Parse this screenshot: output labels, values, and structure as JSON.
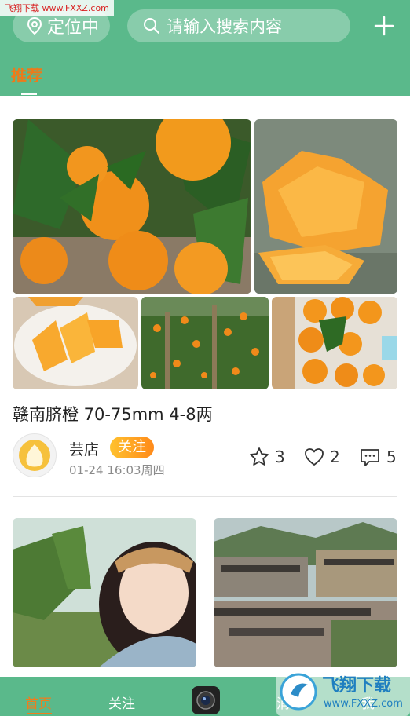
{
  "watermark": {
    "text": "飞翔下载 www.FXXZ.com"
  },
  "header": {
    "location_label": "定位中",
    "search_placeholder": "请输入搜索内容",
    "tab_recommend": "推荐"
  },
  "post": {
    "title": "赣南脐橙 70-75mm 4-8两",
    "shop_name": "芸店",
    "follow_label": "关注",
    "time": "01-24  16:03周四",
    "stars": "3",
    "likes": "2",
    "comments": "5"
  },
  "bottom_nav": {
    "home": "首页",
    "follow": "关注",
    "message": "消",
    "me": "我"
  },
  "logo_watermark": {
    "title": "飞翔下载",
    "url": "www.FXXZ.com"
  },
  "colors": {
    "header_bg": "#5ab98b",
    "accent_orange": "#ee7a1a",
    "follow_gradient_start": "#ffc22e",
    "follow_gradient_end": "#ff8a1a"
  }
}
